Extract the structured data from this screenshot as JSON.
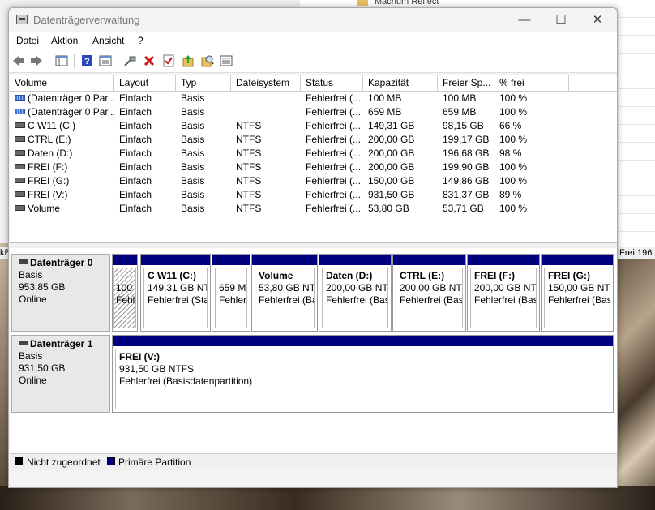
{
  "background": {
    "top_app_text": "Macrium Reflect",
    "left_fragment": "kB",
    "right_fragment": "Frei 196"
  },
  "window": {
    "title": "Datenträgerverwaltung",
    "minimize": "—",
    "maximize": "☐",
    "close": "✕"
  },
  "menu": [
    "Datei",
    "Aktion",
    "Ansicht",
    "?"
  ],
  "toolbar": [
    "back-arrow-icon",
    "forward-arrow-icon",
    "console-tree-icon",
    "help-icon",
    "properties-icon",
    "connect-icon",
    "delete-icon",
    "check-icon",
    "refresh-icon",
    "search-icon",
    "list-icon"
  ],
  "columns": [
    "Volume",
    "Layout",
    "Typ",
    "Dateisystem",
    "Status",
    "Kapazität",
    "Freier Sp...",
    "% frei"
  ],
  "volumes": [
    {
      "icon": "p",
      "name": "(Datenträger 0 Par...",
      "layout": "Einfach",
      "type": "Basis",
      "fs": "",
      "status": "Fehlerfrei (...",
      "capacity": "100 MB",
      "free": "100 MB",
      "pct": "100 %"
    },
    {
      "icon": "p",
      "name": "(Datenträger 0 Par...",
      "layout": "Einfach",
      "type": "Basis",
      "fs": "",
      "status": "Fehlerfrei (...",
      "capacity": "659 MB",
      "free": "659 MB",
      "pct": "100 %"
    },
    {
      "icon": "d",
      "name": "C W11 (C:)",
      "layout": "Einfach",
      "type": "Basis",
      "fs": "NTFS",
      "status": "Fehlerfrei (...",
      "capacity": "149,31 GB",
      "free": "98,15 GB",
      "pct": "66 %"
    },
    {
      "icon": "d",
      "name": "CTRL (E:)",
      "layout": "Einfach",
      "type": "Basis",
      "fs": "NTFS",
      "status": "Fehlerfrei (...",
      "capacity": "200,00 GB",
      "free": "199,17 GB",
      "pct": "100 %"
    },
    {
      "icon": "d",
      "name": "Daten (D:)",
      "layout": "Einfach",
      "type": "Basis",
      "fs": "NTFS",
      "status": "Fehlerfrei (...",
      "capacity": "200,00 GB",
      "free": "196,68 GB",
      "pct": "98 %"
    },
    {
      "icon": "d",
      "name": "FREI (F:)",
      "layout": "Einfach",
      "type": "Basis",
      "fs": "NTFS",
      "status": "Fehlerfrei (...",
      "capacity": "200,00 GB",
      "free": "199,90 GB",
      "pct": "100 %"
    },
    {
      "icon": "d",
      "name": "FREI (G:)",
      "layout": "Einfach",
      "type": "Basis",
      "fs": "NTFS",
      "status": "Fehlerfrei (...",
      "capacity": "150,00 GB",
      "free": "149,86 GB",
      "pct": "100 %"
    },
    {
      "icon": "d",
      "name": "FREI (V:)",
      "layout": "Einfach",
      "type": "Basis",
      "fs": "NTFS",
      "status": "Fehlerfrei (...",
      "capacity": "931,50 GB",
      "free": "831,37 GB",
      "pct": "89 %"
    },
    {
      "icon": "d",
      "name": "Volume",
      "layout": "Einfach",
      "type": "Basis",
      "fs": "NTFS",
      "status": "Fehlerfrei (...",
      "capacity": "53,80 GB",
      "free": "53,71 GB",
      "pct": "100 %"
    }
  ],
  "disk0": {
    "name": "Datenträger 0",
    "type": "Basis",
    "size": "953,85 GB",
    "state": "Online",
    "partitions": [
      {
        "name": "",
        "line1": "100 M",
        "line2": "Fehl",
        "hatched": true
      },
      {
        "name": "C W11  (C:)",
        "line1": "149,31 GB NTFS",
        "line2": "Fehlerfrei (Sta"
      },
      {
        "name": "",
        "line1": "659 M",
        "line2": "Fehler"
      },
      {
        "name": "Volume",
        "line1": "53,80 GB NTFS",
        "line2": "Fehlerfrei (Ba"
      },
      {
        "name": "Daten  (D:)",
        "line1": "200,00 GB NTFS",
        "line2": "Fehlerfrei (Basi"
      },
      {
        "name": "CTRL  (E:)",
        "line1": "200,00 GB NTFS",
        "line2": "Fehlerfrei (Basi"
      },
      {
        "name": "FREI  (F:)",
        "line1": "200,00 GB NTFS",
        "line2": "Fehlerfrei (Basi"
      },
      {
        "name": "FREI  (G:)",
        "line1": "150,00 GB NTFS",
        "line2": "Fehlerfrei (Basi"
      }
    ]
  },
  "disk1": {
    "name": "Datenträger 1",
    "type": "Basis",
    "size": "931,50 GB",
    "state": "Online",
    "partition": {
      "name": "FREI  (V:)",
      "line1": "931,50 GB NTFS",
      "line2": "Fehlerfrei (Basisdatenpartition)"
    }
  },
  "legend": [
    {
      "label": "Nicht zugeordnet",
      "color": "#000000"
    },
    {
      "label": "Primäre Partition",
      "color": "#000080"
    }
  ]
}
